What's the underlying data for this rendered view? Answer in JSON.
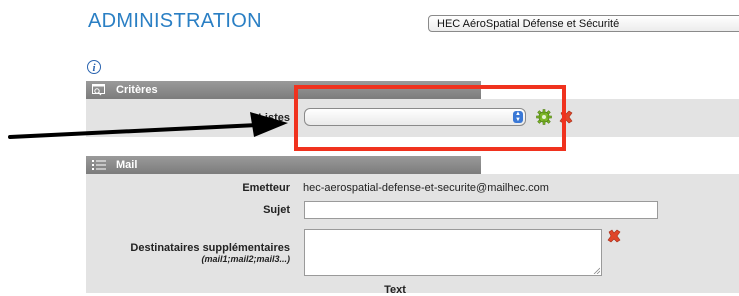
{
  "header": {
    "title": "ADMINISTRATION",
    "organization_select": {
      "value": "HEC AéroSpatial Défense et Sécurité"
    }
  },
  "criteres": {
    "title": "Critères",
    "listes_label": "Listes",
    "listes_select_value": ""
  },
  "mail": {
    "title": "Mail",
    "emetteur_label": "Emetteur",
    "emetteur_value": "hec-aerospatial-defense-et-securite@mailhec.com",
    "sujet_label": "Sujet",
    "sujet_value": "",
    "destinataires_label": "Destinataires supplémentaires",
    "destinataires_hint": "(mail1;mail2;mail3...)",
    "destinataires_value": "",
    "text_label": "Text"
  },
  "icons": {
    "info": "info-icon",
    "criteres": "search-window-icon",
    "mail": "list-icon",
    "gear": "gear-icon",
    "delete": "delete-x-icon"
  },
  "colors": {
    "title": "#2a7fc4",
    "section_header": "#8a8a8a",
    "section_body": "#e3e3e3",
    "highlight": "#f0321e",
    "delete": "#e0452a",
    "gear": "#7fb82a"
  }
}
